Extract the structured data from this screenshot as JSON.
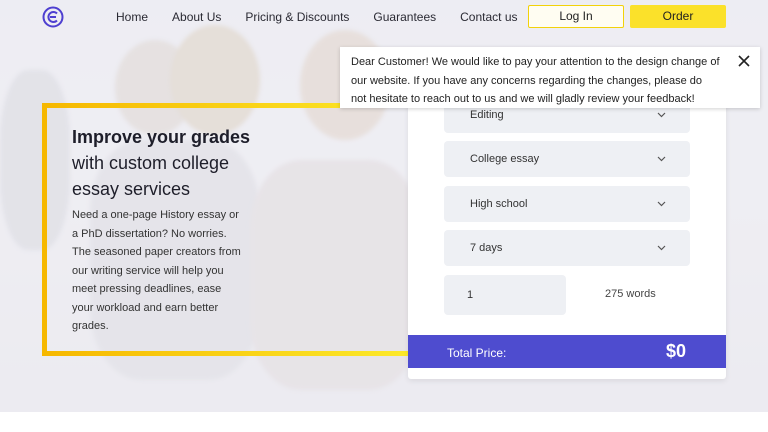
{
  "header": {
    "nav": [
      "Home",
      "About Us",
      "Pricing & Discounts",
      "Guarantees",
      "Contact us"
    ],
    "login_label": "Log In",
    "order_label": "Order"
  },
  "hero": {
    "title_bold": "Improve your grades",
    "title_rest": "with custom college essay services",
    "description": "Need a one-page History essay or a PhD dissertation? No worries. The seasoned paper creators from our writing service will help you meet pressing deadlines, ease your workload and earn better grades."
  },
  "calculator": {
    "selects": [
      "Editing",
      "College essay",
      "High school",
      "7 days"
    ],
    "quantity": "1",
    "words": "275 words",
    "total_label": "Total Price:",
    "total_price": "$0"
  },
  "notice": {
    "text": "Dear Customer! We would like to pay your attention to the design change of our website. If you have any concerns regarding the changes, please do not hesitate to reach out to us and we will gladly review your feedback!"
  },
  "colors": {
    "accent_yellow": "#fbe12a",
    "frame_orange": "#f6b800",
    "total_bar": "#4e4ccf",
    "logo_purple": "#4e3fd0"
  },
  "icons": {
    "logo": "brand-logo-icon",
    "close": "close-icon",
    "chevron": "chevron-down-icon"
  }
}
